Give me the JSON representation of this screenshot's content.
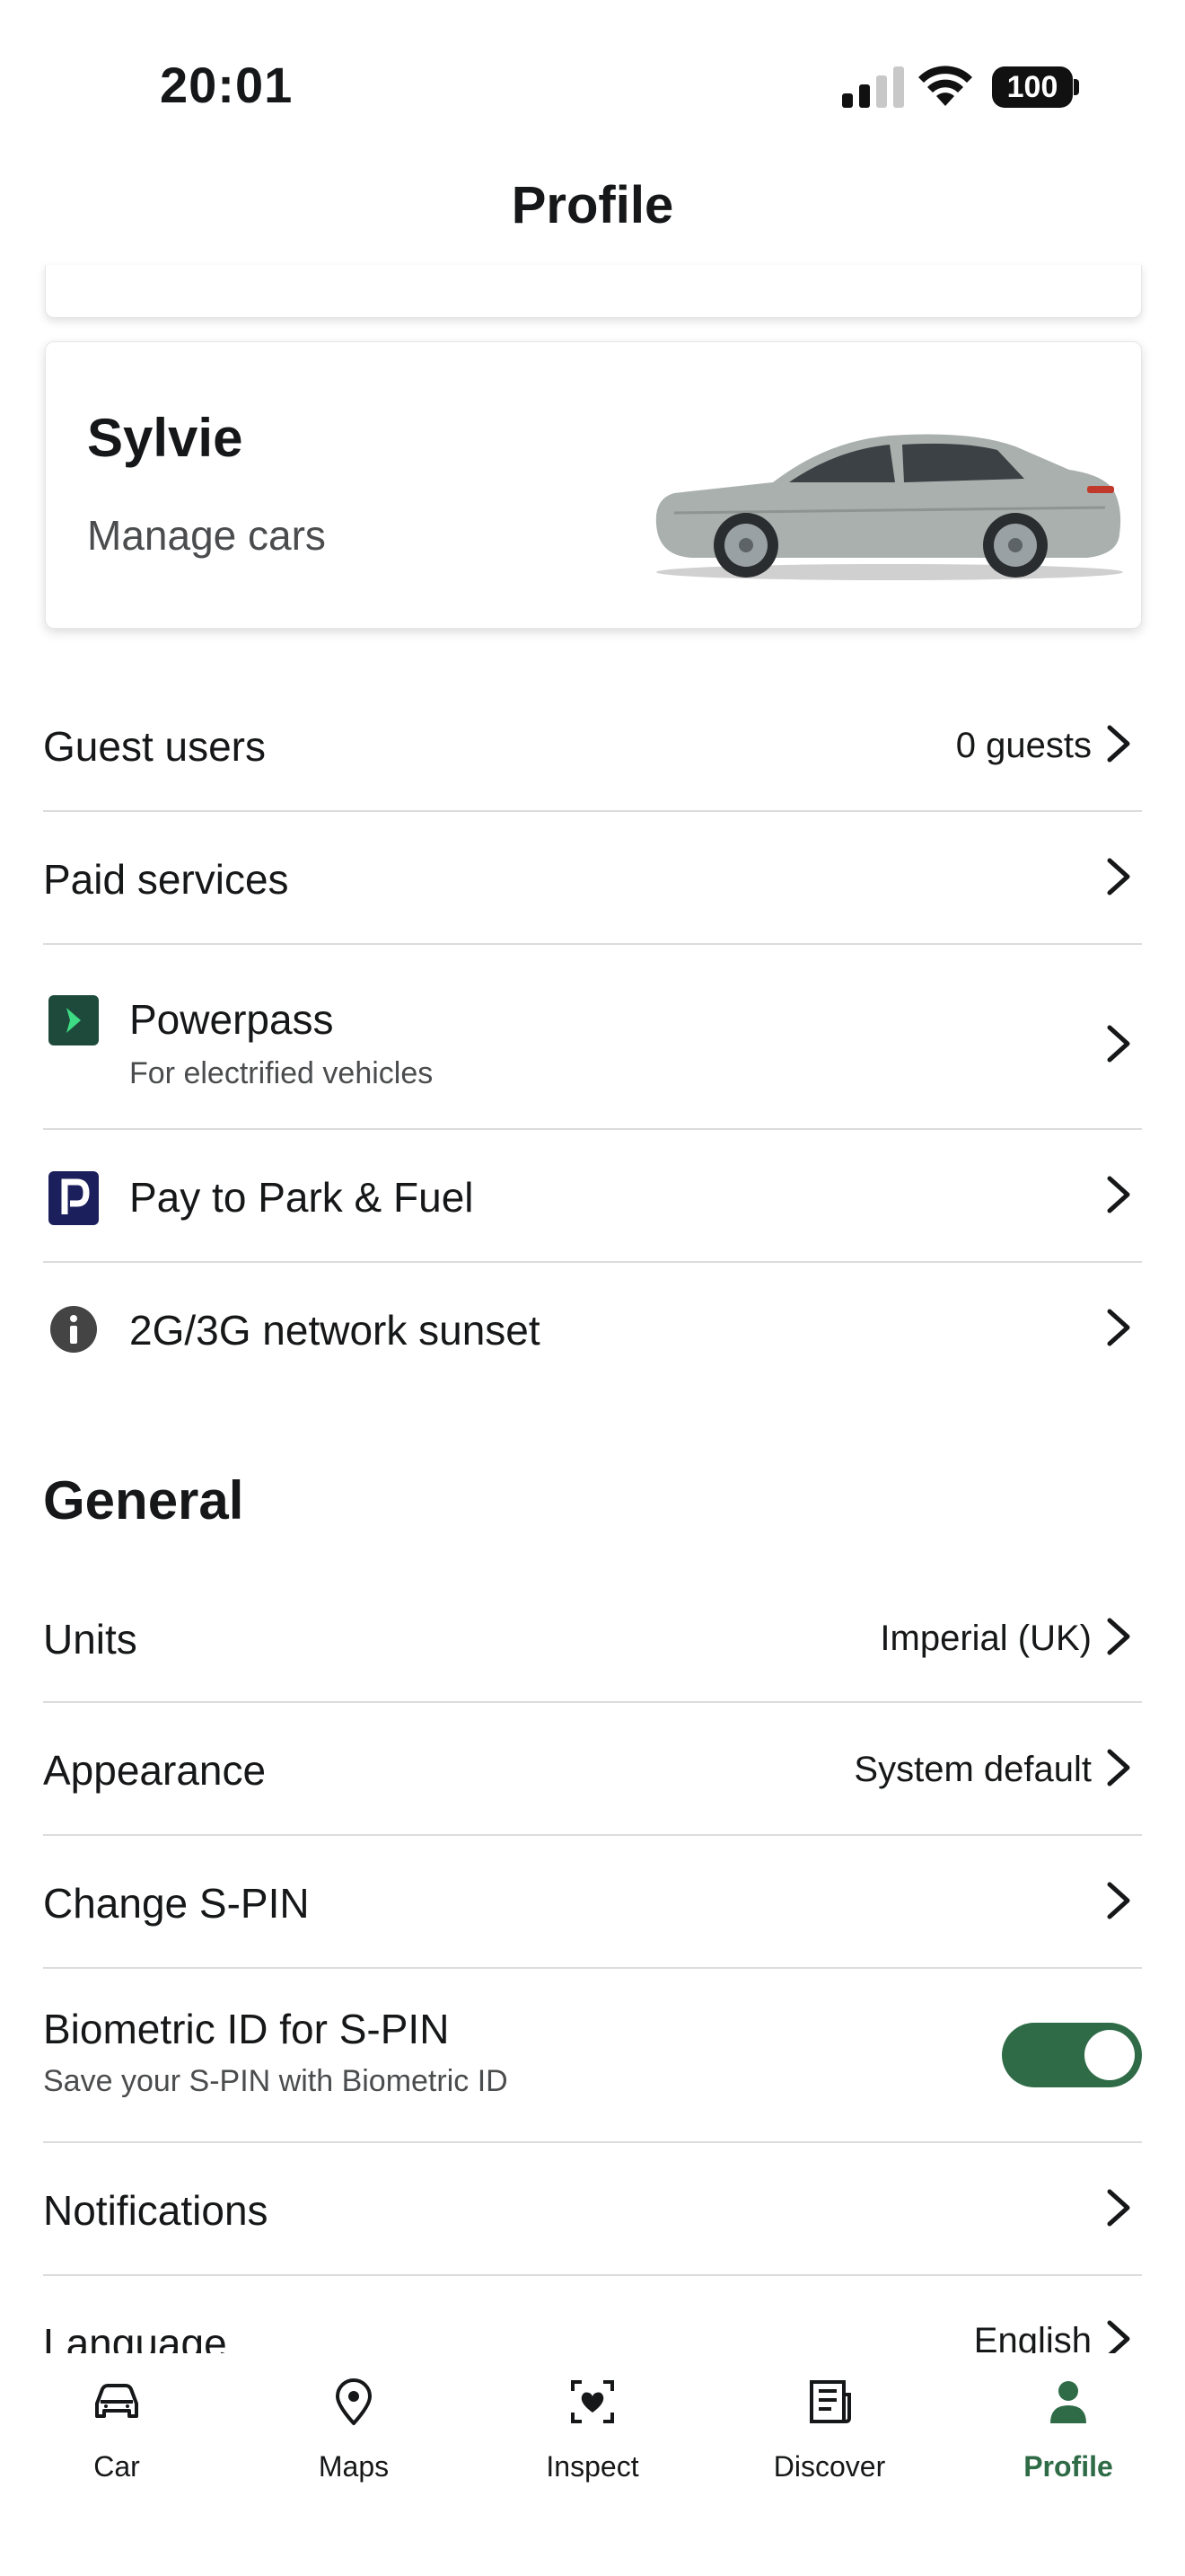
{
  "status_bar": {
    "time": "20:01",
    "battery": "100"
  },
  "header": {
    "title": "Profile"
  },
  "car_card": {
    "name": "Sylvie",
    "action": "Manage cars"
  },
  "rows": {
    "guest_users": {
      "label": "Guest users",
      "value": "0 guests"
    },
    "paid_services": {
      "label": "Paid services"
    },
    "powerpass": {
      "label": "Powerpass",
      "sub": "For electrified vehicles"
    },
    "pay_to_park": {
      "label": "Pay to Park & Fuel"
    },
    "network_sunset": {
      "label": "2G/3G network sunset"
    }
  },
  "general": {
    "title": "General",
    "units": {
      "label": "Units",
      "value": "Imperial (UK)"
    },
    "appearance": {
      "label": "Appearance",
      "value": "System default"
    },
    "change_spin": {
      "label": "Change S-PIN"
    },
    "biometric": {
      "label": "Biometric ID for S-PIN",
      "sub": "Save your S-PIN with Biometric ID",
      "enabled": true
    },
    "notifications": {
      "label": "Notifications"
    },
    "language": {
      "label": "Language",
      "value": "English"
    }
  },
  "nav": {
    "items": [
      {
        "label": "Car",
        "icon": "car-icon"
      },
      {
        "label": "Maps",
        "icon": "map-pin-icon"
      },
      {
        "label": "Inspect",
        "icon": "inspect-icon"
      },
      {
        "label": "Discover",
        "icon": "news-icon"
      },
      {
        "label": "Profile",
        "icon": "person-icon",
        "active": true
      }
    ]
  },
  "colors": {
    "accent": "#2e6b46",
    "powerpass_bg": "#1d4a3a",
    "powerpass_arrow": "#3ddc84",
    "parking_bg": "#1b1f5c"
  }
}
